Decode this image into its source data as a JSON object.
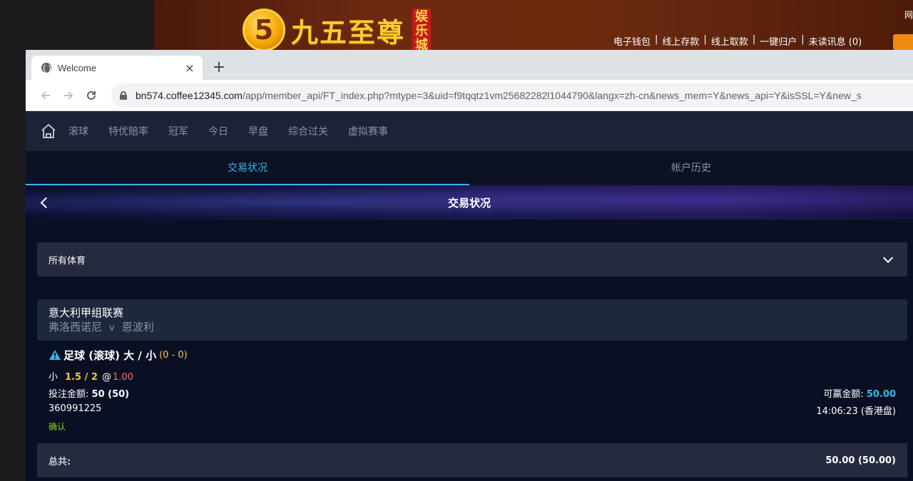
{
  "background_site": {
    "logo_glyph": "5",
    "logo_text": "九五至尊",
    "logo_badge": [
      "娱",
      "乐",
      "城"
    ],
    "links": [
      "电子钱包",
      "线上存款",
      "线上取款",
      "一键归户",
      "未读讯息 (0)"
    ],
    "separator": "|",
    "corner_text": "网"
  },
  "browser": {
    "tab_title": "Welcome",
    "tab_close": "×",
    "new_tab": "+",
    "url_host": "bn574.coffee12345.com",
    "url_path": "/app/member_api/FT_index.php?mtype=3&uid=f9tqqtz1vm25682282l1044790&langx=zh-cn&news_mem=Y&news_api=Y&isSSL=Y&new_s"
  },
  "topnav": {
    "items": [
      "滚球",
      "特优赔率",
      "冠军",
      "今日",
      "早盘",
      "综合过关",
      "虚拟赛事"
    ]
  },
  "subtabs": {
    "active": "交易状况",
    "other": "帐户历史"
  },
  "title": "交易状况",
  "filter": {
    "selected": "所有体育"
  },
  "bet": {
    "league": "意大利甲组联赛",
    "home": "弗洛西诺尼",
    "vs": "v",
    "away": "恩波利",
    "type": "足球 (滚球) 大 / 小",
    "score": "(0 - 0)",
    "side": "小",
    "line": "1.5 / 2",
    "at": "@",
    "odds": "1.00",
    "stake_label": "投注金额:",
    "stake_value": "50 (50)",
    "win_label": "可赢金额:",
    "win_value": "50.00",
    "ticket_id": "360991225",
    "time": "14:06:23 (香港盘)",
    "status": "确认"
  },
  "total": {
    "label": "总共:",
    "value": "50.00 (50.00)"
  },
  "colors": {
    "accent": "#35b8e8",
    "odds": "#ff6b6b",
    "line": "#f2c94c",
    "confirmed": "#7ed321",
    "page_bg": "#0a1023"
  }
}
